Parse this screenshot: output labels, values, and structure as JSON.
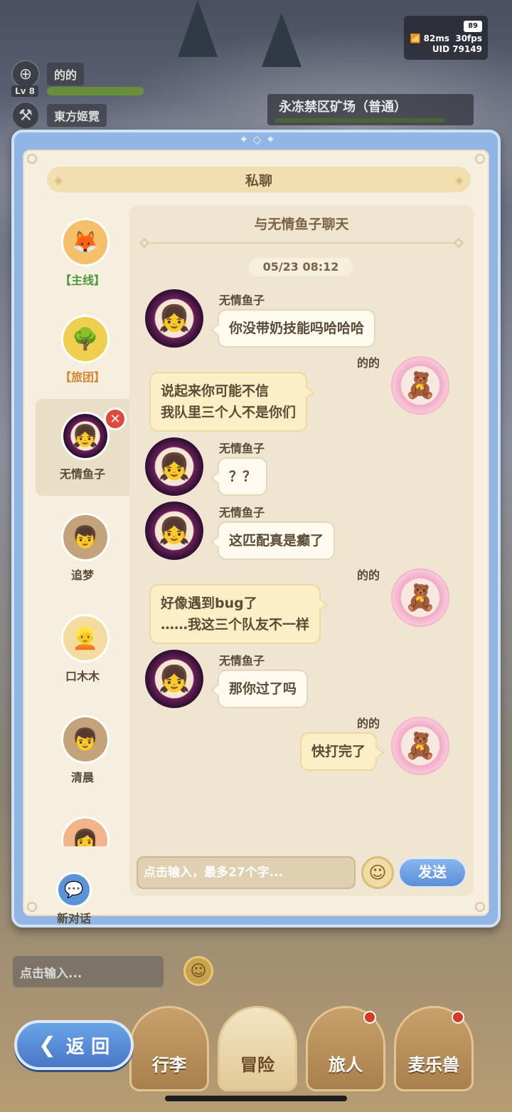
{
  "status": {
    "battery": "89",
    "ping": "82ms",
    "fps": "30fps",
    "uid": "UID 79149"
  },
  "players": [
    {
      "name": "的的",
      "level": "Lv 8",
      "hp_fraction": 1.0
    },
    {
      "name": "東方姬霓"
    }
  ],
  "zone": {
    "name": "永冻禁区矿场（普通）"
  },
  "dialog": {
    "title": "私聊",
    "chat_title": "与无情鱼子聊天",
    "timestamp": "05/23  08:12",
    "input_placeholder": "点击输入，最多27个字...",
    "send_label": "发送",
    "new_chat_label": "新对话"
  },
  "contacts": [
    {
      "label": "【主线】",
      "icon": "fox-boy-avatar"
    },
    {
      "label": "【旅团】",
      "icon": "golden-tree-avatar"
    },
    {
      "label": "无情鱼子",
      "icon": "girl-avatar",
      "selected": true
    },
    {
      "label": "追梦",
      "icon": "boy-avatar"
    },
    {
      "label": "口木木",
      "icon": "blonde-avatar"
    },
    {
      "label": "清晨",
      "icon": "boy-avatar"
    },
    {
      "label": "",
      "icon": "partial-avatar"
    }
  ],
  "messages": [
    {
      "sender": "无情鱼子",
      "side": "in",
      "lines": [
        "你没带奶技能吗哈哈哈"
      ]
    },
    {
      "sender": "的的",
      "side": "out",
      "lines": [
        "说起来你可能不信",
        "我队里三个人不是你们"
      ]
    },
    {
      "sender": "无情鱼子",
      "side": "in",
      "lines": [
        "？？"
      ]
    },
    {
      "sender": "无情鱼子",
      "side": "in",
      "lines": [
        "这匹配真是癫了"
      ]
    },
    {
      "sender": "的的",
      "side": "out",
      "lines": [
        "好像遇到bug了",
        "……我这三个队友不一样"
      ]
    },
    {
      "sender": "无情鱼子",
      "side": "in",
      "lines": [
        "那你过了吗"
      ]
    },
    {
      "sender": "的的",
      "side": "out",
      "lines": [
        "快打完了"
      ]
    }
  ],
  "world_chat": {
    "placeholder": "点击输入..."
  },
  "bottom_nav": {
    "back_label": "返 回",
    "items": [
      {
        "label": "行李"
      },
      {
        "label": "冒险",
        "active": true
      },
      {
        "label": "旅人",
        "badge": true
      },
      {
        "label": "麦乐兽",
        "badge": true
      }
    ]
  },
  "colors": {
    "modal_frame": "#8fb6e4",
    "panel_bg": "#f6efe0",
    "send_button": "#5b8fd8",
    "tag_mainline": "#4d9a3b",
    "tag_guild": "#d9852f",
    "close_badge": "#e0493b"
  }
}
